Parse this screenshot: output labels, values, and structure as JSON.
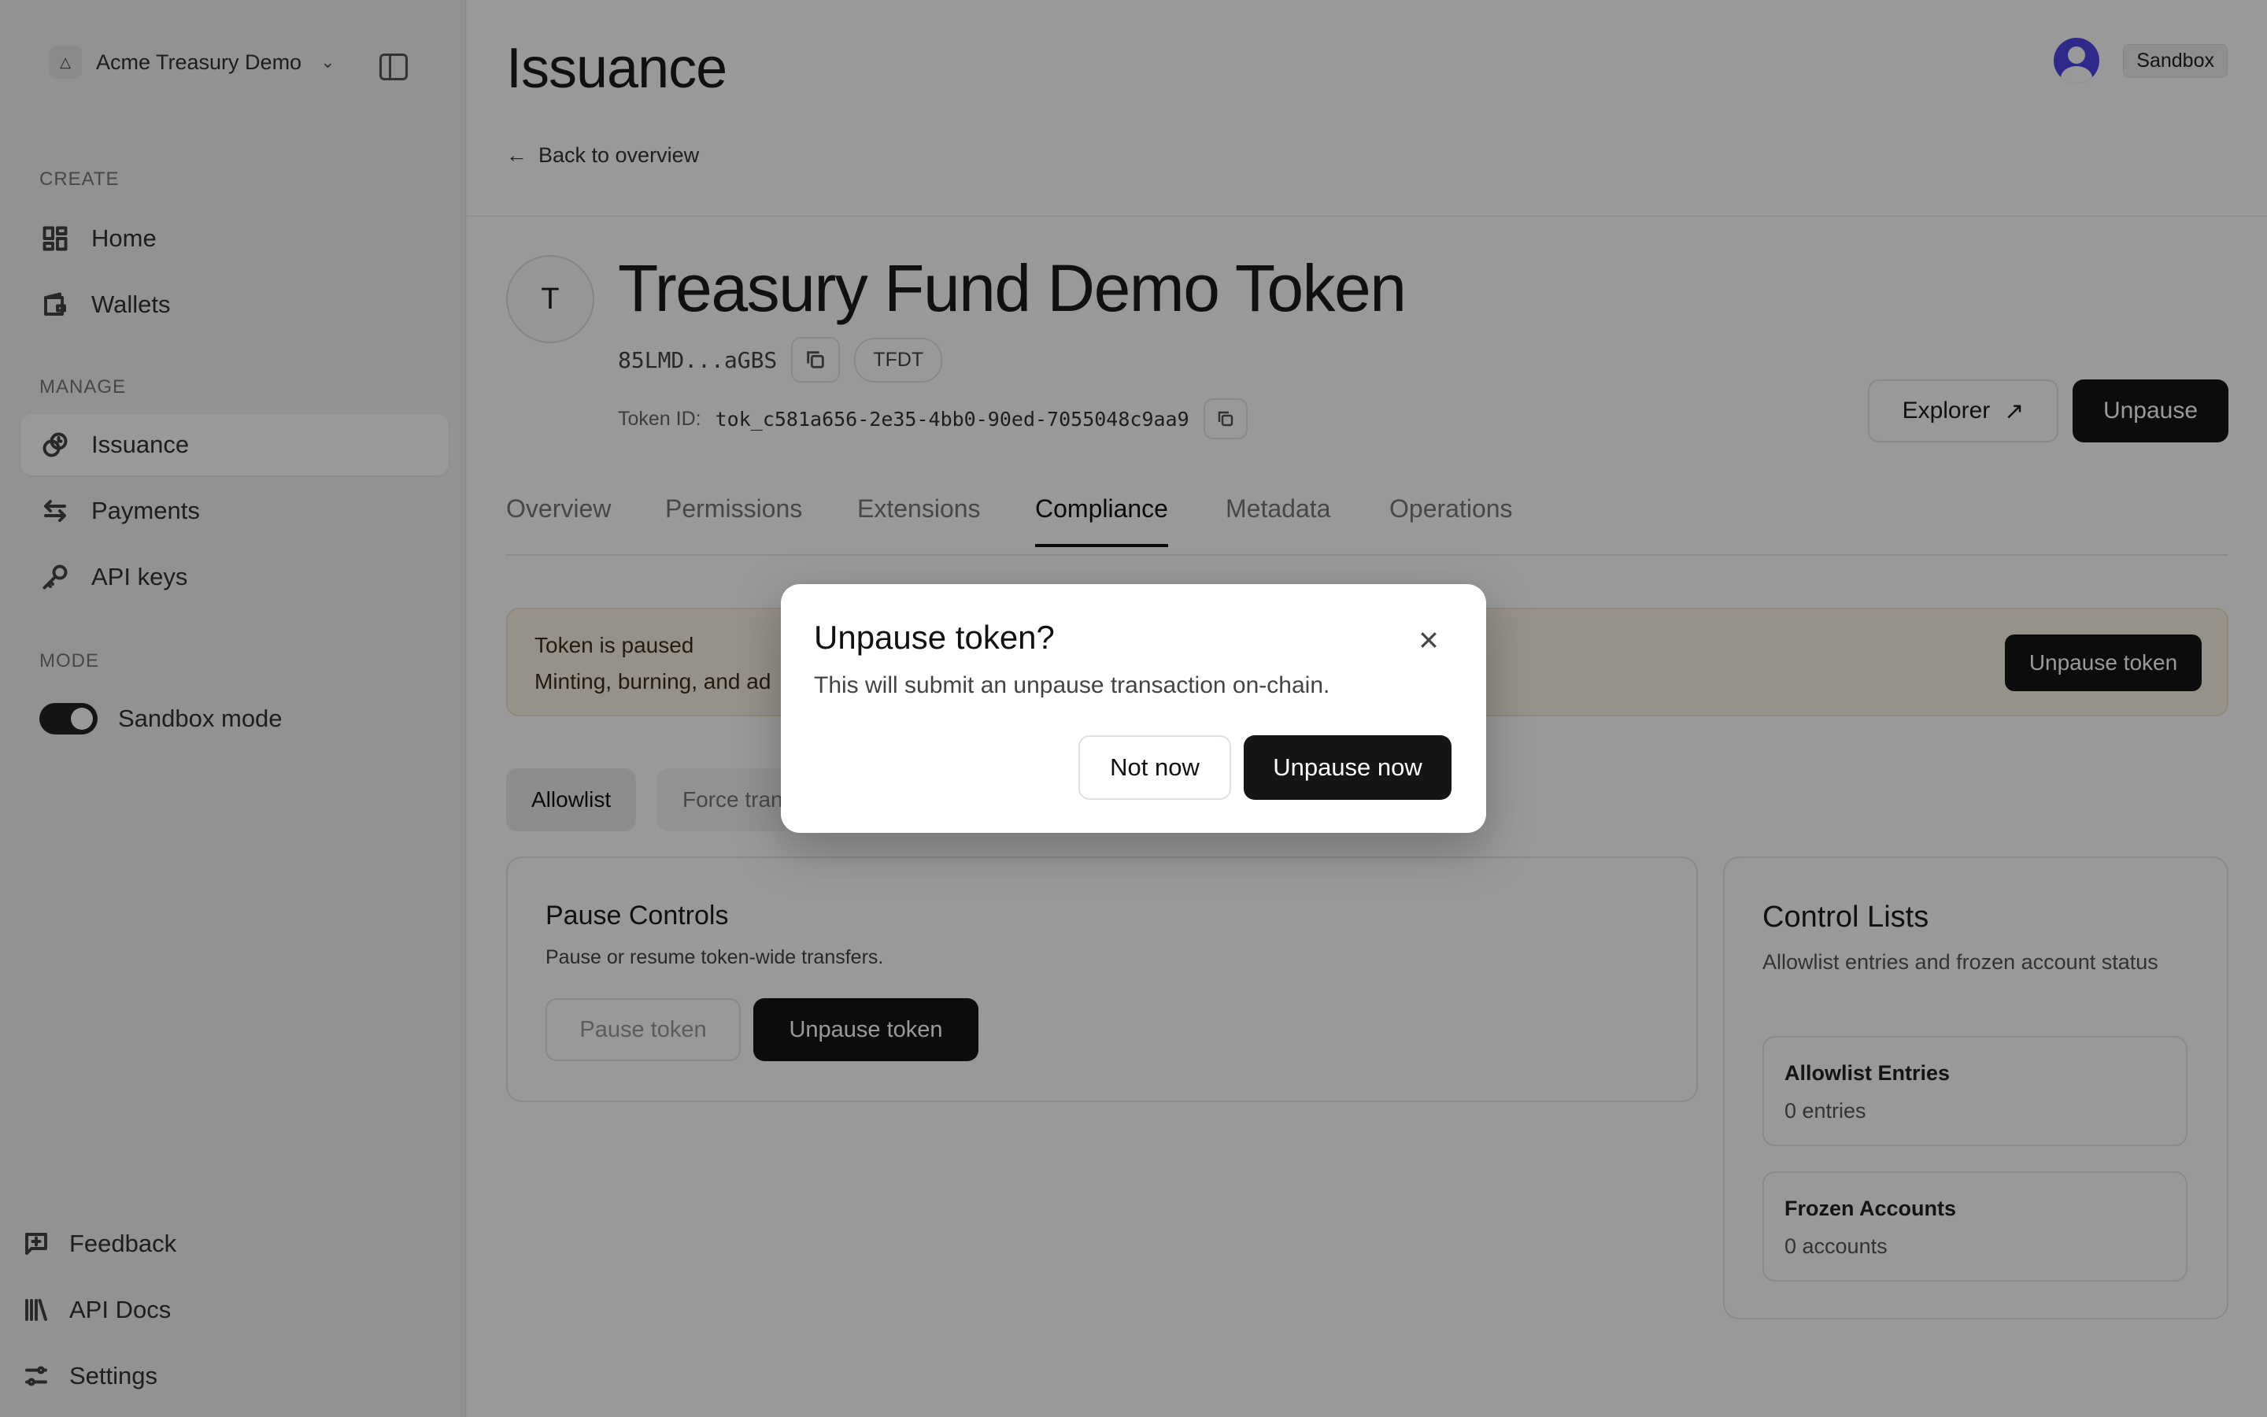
{
  "sidebar": {
    "org_name": "Acme Treasury Demo",
    "org_logo_glyph": "△",
    "sections": {
      "create": "CREATE",
      "manage": "MANAGE",
      "mode": "MODE"
    },
    "create_items": [
      {
        "label": "Home",
        "icon": "grid-icon"
      },
      {
        "label": "Wallets",
        "icon": "wallet-icon"
      }
    ],
    "manage_items": [
      {
        "label": "Issuance",
        "icon": "issuance-icon",
        "active": true
      },
      {
        "label": "Payments",
        "icon": "arrows-icon"
      },
      {
        "label": "API keys",
        "icon": "key-icon"
      }
    ],
    "mode_toggle": {
      "label": "Sandbox mode",
      "on": true
    },
    "footer_items": [
      {
        "label": "Feedback",
        "icon": "feedback-icon"
      },
      {
        "label": "API Docs",
        "icon": "library-icon"
      },
      {
        "label": "Settings",
        "icon": "sliders-icon"
      }
    ]
  },
  "header": {
    "title": "Issuance",
    "back_label": "Back to overview",
    "env_badge": "Sandbox"
  },
  "token": {
    "avatar_letter": "T",
    "name": "Treasury Fund Demo Token",
    "address_short": "85LMD...aGBS",
    "symbol": "TFDT",
    "token_id_label": "Token ID:",
    "token_id": "tok_c581a656-2e35-4bb0-90ed-7055048c9aa9",
    "explorer_label": "Explorer",
    "unpause_label": "Unpause"
  },
  "tabs": [
    {
      "label": "Overview",
      "active": false
    },
    {
      "label": "Permissions",
      "active": false
    },
    {
      "label": "Extensions",
      "active": false
    },
    {
      "label": "Compliance",
      "active": true
    },
    {
      "label": "Metadata",
      "active": false
    },
    {
      "label": "Operations",
      "active": false
    }
  ],
  "banner": {
    "title": "Token is paused",
    "desc": "Minting, burning, and ad",
    "button": "Unpause token"
  },
  "subtabs": [
    {
      "label": "Allowlist",
      "active": true
    },
    {
      "label": "Force tran",
      "active": false
    }
  ],
  "pause_card": {
    "title": "Pause Controls",
    "desc": "Pause or resume token-wide transfers.",
    "pause_button": "Pause token",
    "unpause_button": "Unpause token"
  },
  "control_lists": {
    "title": "Control Lists",
    "desc": "Allowlist entries and frozen account status",
    "allowlist": {
      "title": "Allowlist Entries",
      "value": "0 entries"
    },
    "frozen": {
      "title": "Frozen Accounts",
      "value": "0 accounts"
    }
  },
  "modal": {
    "title": "Unpause token?",
    "desc": "This will submit an unpause transaction on-chain.",
    "cancel": "Not now",
    "confirm": "Unpause now"
  },
  "colors": {
    "primary_button": "#151515",
    "banner_bg": "#fbf2e4",
    "avatar": "#4f46e5",
    "overlay": "rgba(0,0,0,0.40)"
  }
}
